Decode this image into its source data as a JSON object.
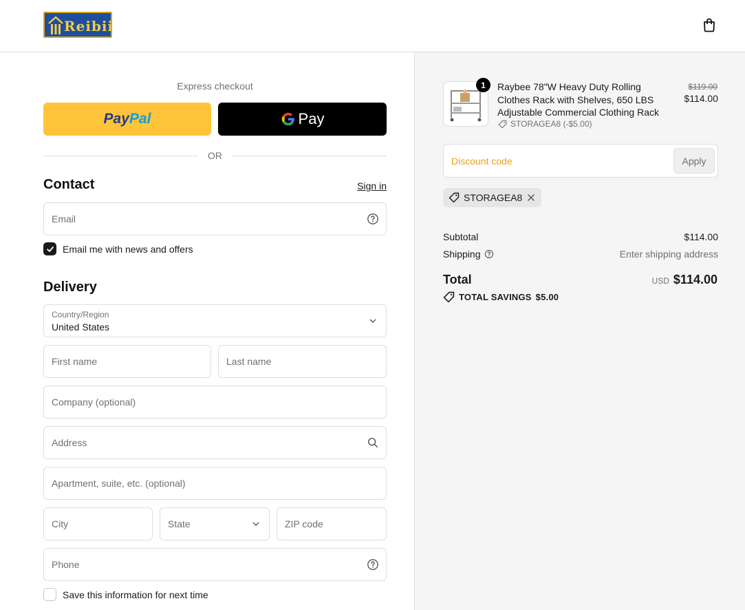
{
  "header": {
    "logo_text": "Reibii",
    "cart_icon": "shopping-bag-icon"
  },
  "express": {
    "label": "Express checkout",
    "paypal_part1": "Pay",
    "paypal_part2": "Pal",
    "gpay_label": "Pay",
    "or_text": "OR"
  },
  "contact": {
    "title": "Contact",
    "signin_label": "Sign in",
    "email_placeholder": "Email",
    "newsletter_label": "Email me with news and offers",
    "newsletter_checked": true
  },
  "delivery": {
    "title": "Delivery",
    "country_label": "Country/Region",
    "country_value": "United States",
    "first_name_placeholder": "First name",
    "last_name_placeholder": "Last name",
    "company_placeholder": "Company (optional)",
    "address_placeholder": "Address",
    "apartment_placeholder": "Apartment, suite, etc. (optional)",
    "city_placeholder": "City",
    "state_label": "State",
    "zip_placeholder": "ZIP code",
    "phone_placeholder": "Phone",
    "save_info_label": "Save this information for next time",
    "save_info_checked": false
  },
  "summary": {
    "product": {
      "quantity": "1",
      "title": "Raybee 78\"W Heavy Duty Rolling Clothes Rack with Shelves, 650 LBS Adjustable Commercial Clothing Rack",
      "discount": "STORAGEA8 (-$5.00)",
      "original_price": "$119.00",
      "price": "$114.00"
    },
    "discount_placeholder": "Discount code",
    "apply_label": "Apply",
    "applied_code": "STORAGEA8",
    "subtotal_label": "Subtotal",
    "subtotal_value": "$114.00",
    "shipping_label": "Shipping",
    "shipping_value": "Enter shipping address",
    "total_label": "Total",
    "currency": "USD",
    "total_value": "$114.00",
    "savings_label": "TOTAL SAVINGS",
    "savings_value": "$5.00"
  },
  "colors": {
    "paypal_yellow": "#ffc439",
    "discount_placeholder": "#e8a21a",
    "panel_bg": "#f5f5f5"
  }
}
